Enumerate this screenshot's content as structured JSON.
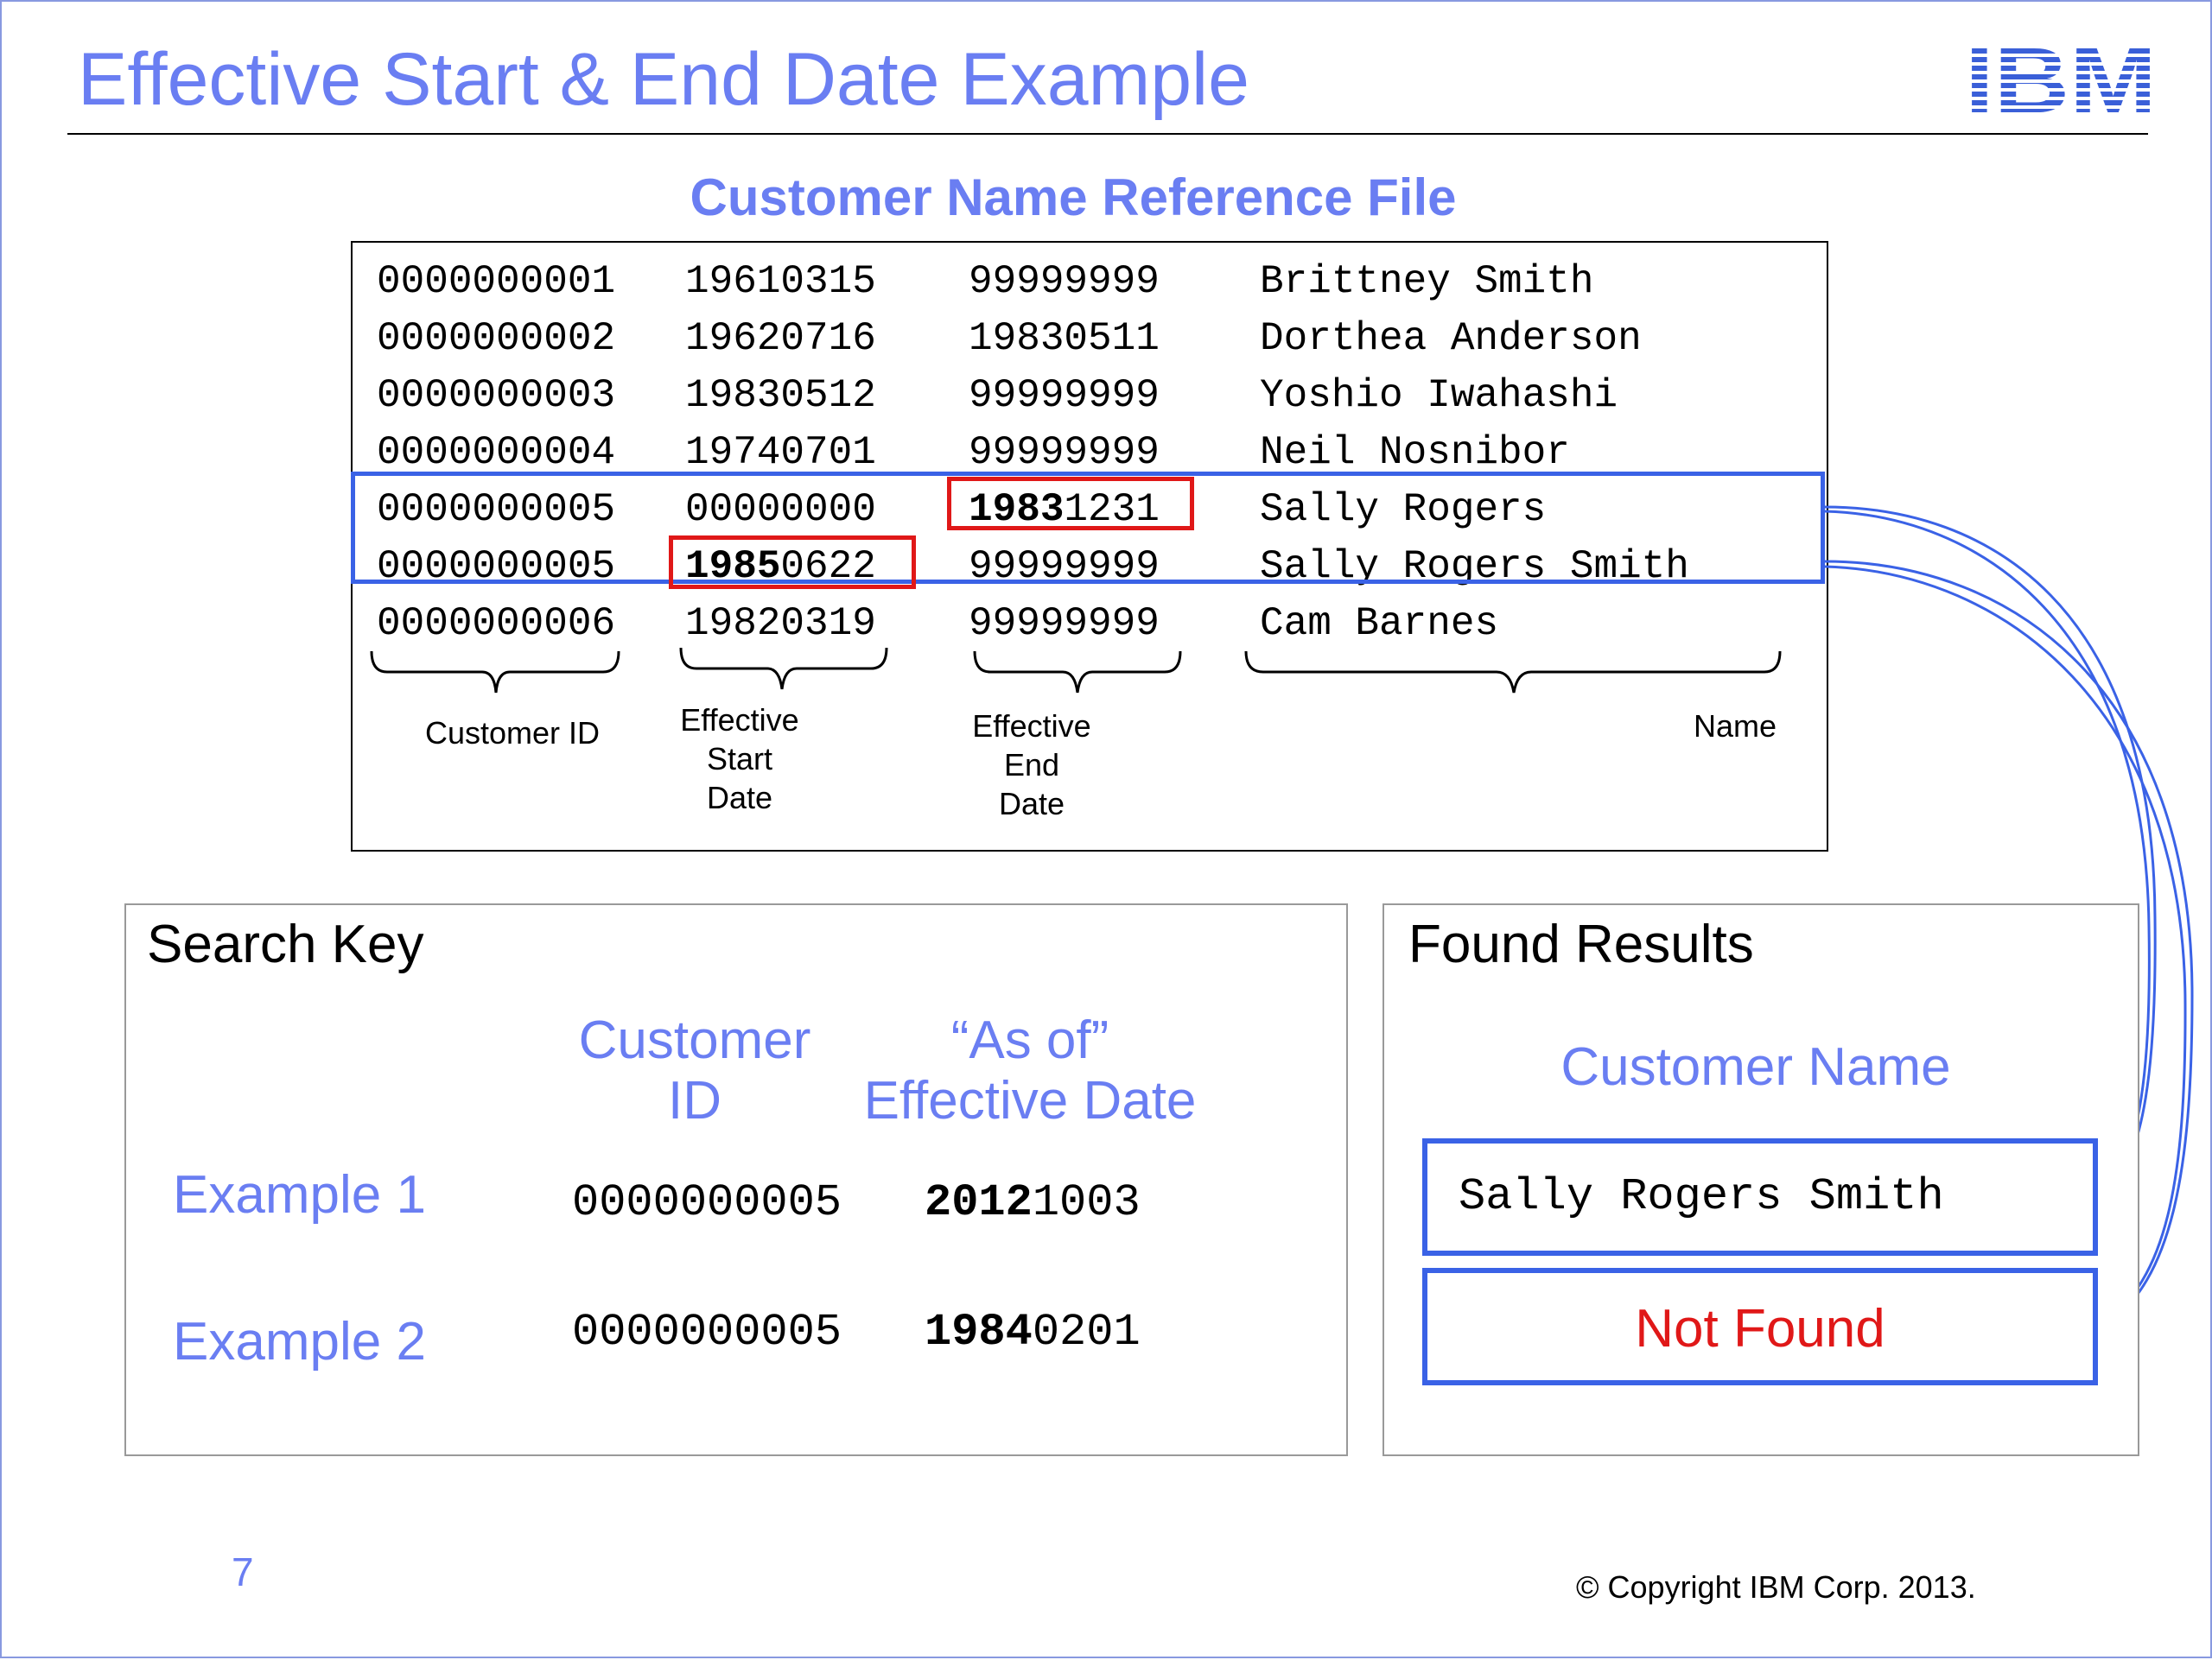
{
  "slide": {
    "title": "Effective Start & End Date Example",
    "logo_text": "IBM",
    "page_number": "7",
    "copyright": "© Copyright IBM Corp. 2013."
  },
  "reference_file": {
    "title": "Customer Name Reference File",
    "rows": [
      {
        "id": "0000000001",
        "start": "19610315",
        "end": "99999999",
        "name": "Brittney Smith"
      },
      {
        "id": "0000000002",
        "start": "19620716",
        "end": "19830511",
        "name": "Dorthea Anderson"
      },
      {
        "id": "0000000003",
        "start": "19830512",
        "end": "99999999",
        "name": "Yoshio Iwahashi"
      },
      {
        "id": "0000000004",
        "start": "19740701",
        "end": "99999999",
        "name": "Neil Nosnibor"
      },
      {
        "id": "0000000005",
        "start": "00000000",
        "end_bold": "1983",
        "end_rest": "1231",
        "name": "Sally Rogers"
      },
      {
        "id": "0000000005",
        "start_bold": "1985",
        "start_rest": "0622",
        "end": "99999999",
        "name": "Sally Rogers Smith"
      },
      {
        "id": "0000000006",
        "start": "19820319",
        "end": "99999999",
        "name": "Cam Barnes"
      }
    ],
    "column_labels": {
      "customer_id": "Customer ID",
      "start_line1": "Effective",
      "start_line2": "Start",
      "start_line3": "Date",
      "end_line1": "Effective",
      "end_line2": "End",
      "end_line3": "Date",
      "name": "Name"
    }
  },
  "search_key": {
    "title": "Search Key",
    "col1_line1": "Customer",
    "col1_line2": "ID",
    "col2_line1": "“As of”",
    "col2_line2": "Effective Date",
    "examples": [
      {
        "label": "Example 1",
        "customer_id": "0000000005",
        "date_bold": "2012",
        "date_rest": "1003"
      },
      {
        "label": "Example 2",
        "customer_id": "0000000005",
        "date_bold": "1984",
        "date_rest": "0201"
      }
    ]
  },
  "found_results": {
    "title": "Found Results",
    "column_header": "Customer Name",
    "result1": "Sally Rogers Smith",
    "result2": "Not Found"
  },
  "colors": {
    "accent_blue": "#6a7ef2",
    "highlight_blue": "#3a62e6",
    "highlight_red": "#e01818",
    "not_found_red": "#e01818"
  }
}
